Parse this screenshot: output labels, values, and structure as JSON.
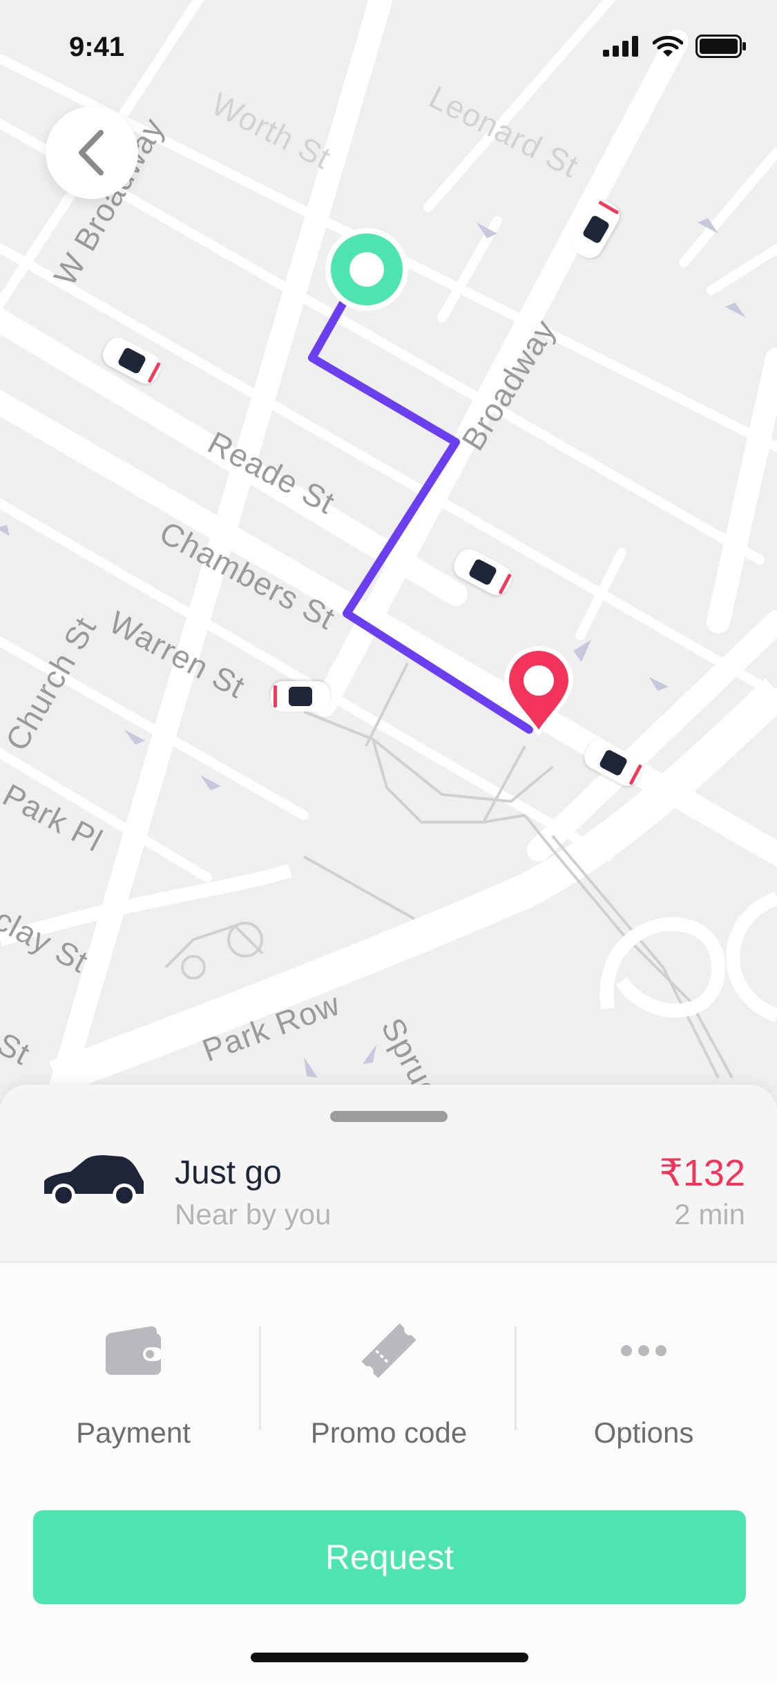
{
  "status_bar": {
    "time": "9:41"
  },
  "map": {
    "streets": {
      "worth": "Worth St",
      "leonard": "Leonard St",
      "w_broadway": "W Broadway",
      "broadway": "Broadway",
      "reade": "Reade St",
      "chambers": "Chambers St",
      "warren": "Warren St",
      "church": "Church St",
      "park_pl": "Park Pl",
      "barclay": "clay St",
      "st_fragment": "St",
      "park_row": "Park Row",
      "spruce": "Spruce"
    },
    "colors": {
      "route": "#6a3ff0",
      "origin": "#4ee4b0",
      "destination": "#f2345a"
    }
  },
  "ride": {
    "name": "Just go",
    "subtitle": "Near by you",
    "price": "₹132",
    "eta": "2 min"
  },
  "options": [
    {
      "label": "Payment",
      "icon": "wallet-icon"
    },
    {
      "label": "Promo code",
      "icon": "ticket-icon"
    },
    {
      "label": "Options",
      "icon": "more-dots-icon"
    }
  ],
  "request_button": {
    "label": "Request"
  }
}
